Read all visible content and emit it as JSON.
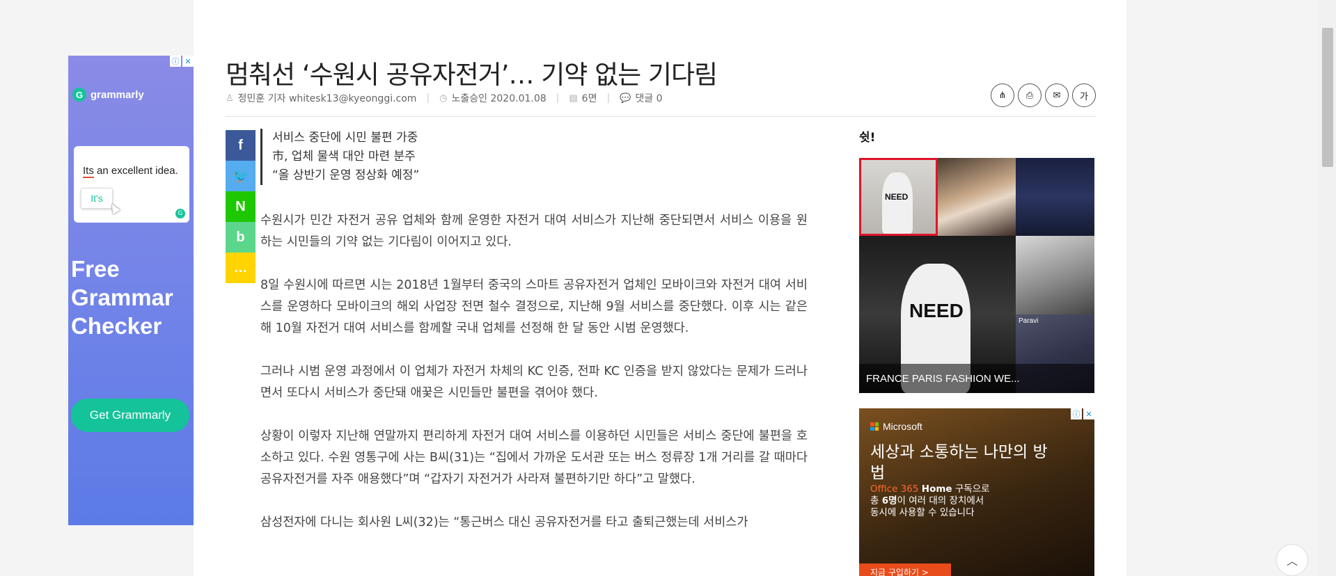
{
  "left_ad": {
    "brand": "grammarly",
    "sample_sentence_error": "Its",
    "sample_sentence_rest": " an excellent idea.",
    "suggestion": "It's",
    "headline": "Free Grammar Checker",
    "cta": "Get Grammarly",
    "brand_color": "#15c39a",
    "ad_info_icon": "ⓘ",
    "ad_close_icon": "✕"
  },
  "article": {
    "title": "멈춰선 ‘수원시 공유자전거’… 기약 없는 기다림",
    "meta": {
      "author": "정민훈 기자 whitesk13@kyeonggi.com",
      "published": "노출승인 2020.01.08",
      "page": "6면",
      "comments": "댓글 0"
    },
    "tools": {
      "share_icon": "⋔",
      "print_icon": "⎙",
      "email_icon": "✉",
      "font_icon": "가"
    },
    "social": {
      "facebook": "f",
      "twitter": "t",
      "naver": "N",
      "band": "b",
      "kakao": "…"
    },
    "subheads": [
      "서비스 중단에 시민 불편 가중",
      "市, 업체 물색 대안 마련 분주",
      "“올 상반기 운영 정상화 예정”"
    ],
    "paragraphs": [
      "수원시가 민간 자전거 공유 업체와 함께 운영한 자전거 대여 서비스가 지난해 중단되면서 서비스 이용을 원하는 시민들의 기약 없는 기다림이 이어지고 있다.",
      "8일 수원시에 따르면 시는 2018년 1월부터 중국의 스마트 공유자전거 업체인 모바이크와 자전거 대여 서비스를 운영하다 모바이크의 해외 사업장 전면 철수 결정으로, 지난해 9월 서비스를 중단했다. 이후 시는 같은 해 10월 자전거 대여 서비스를 함께할 국내 업체를 선정해 한 달 동안 시범 운영했다.",
      "그러나 시범 운영 과정에서 이 업체가 자전거 차체의 KC 인증, 전파 KC 인증을 받지 않았다는 문제가 드러나면서 또다시 서비스가 중단돼 애꿎은 시민들만 불편을 겪어야 했다.",
      "상황이 이렇자 지난해 연말까지 편리하게 자전거 대여 서비스를 이용하던 시민들은 서비스 중단에 불편을 호소하고 있다. 수원 영통구에 사는 B씨(31)는 “집에서 가까운 도서관 또는 버스 정류장 1개 거리를 갈 때마다 공유자전거를 자주 애용했다”며 “갑자기 자전거가 사라져 불편하기만 하다”고 말했다.",
      "삼성전자에 다니는 회사원 L씨(32)는 “통근버스 대신 공유자전거를 타고 출퇴근했는데 서비스가"
    ]
  },
  "sidebar": {
    "hot_title": "쉿!",
    "image_text": "NEED",
    "image_text2": "NEED",
    "paravi_label": "Paravi",
    "caption": "FRANCE PARIS FASHION WE...",
    "ms_ad": {
      "brand": "Microsoft",
      "headline": "세상과 소통하는 나만의 방법",
      "office": "Office 365",
      "home": "Home",
      "line1_rest": " 구독으로",
      "line2_pre": "총 ",
      "line2_bold": "6명",
      "line2_rest": "이 여러 대의 장치에서",
      "line3": "동시에 사용할 수 있습니다",
      "cta": "지금 구입하기 >"
    }
  },
  "ui": {
    "to_top_icon": "︿"
  }
}
